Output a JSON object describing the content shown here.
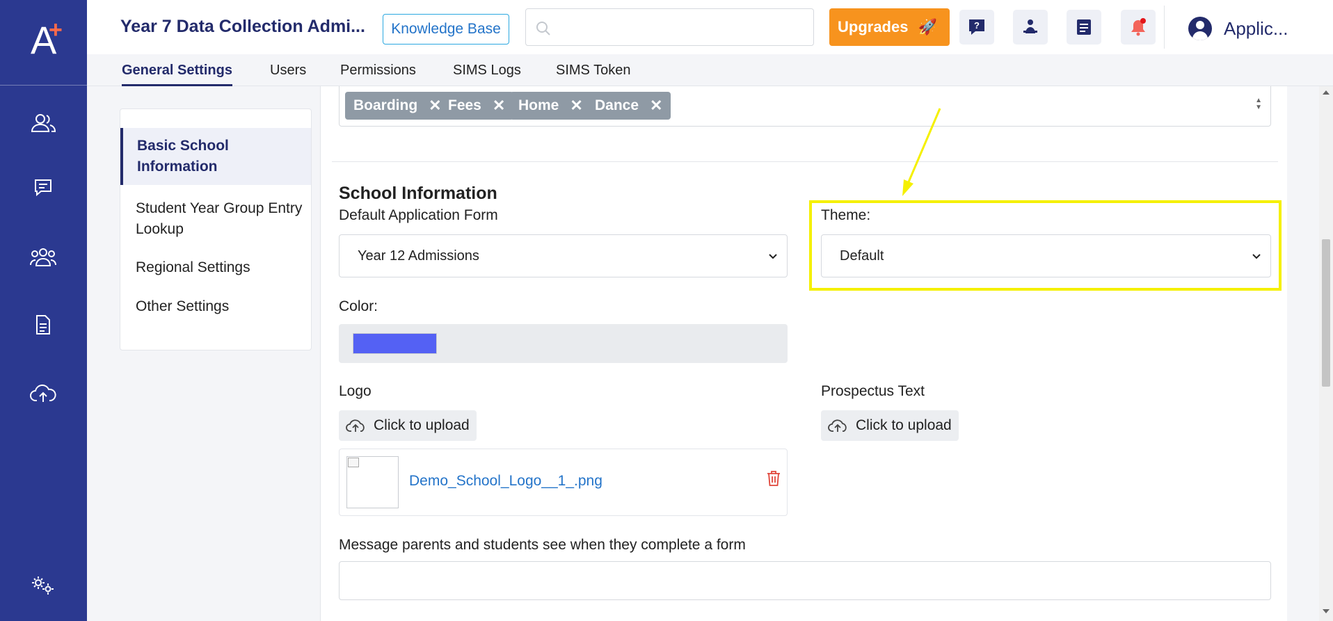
{
  "header": {
    "app_title": "Year 7 Data Collection Admi...",
    "knowledge_base_label": "Knowledge Base",
    "search_placeholder": "",
    "upgrades_label": "Upgrades",
    "user_name": "Applic..."
  },
  "brand": {
    "letter": "A",
    "plus": "+"
  },
  "sidebar": {
    "icons": [
      "users-icon",
      "chat-icon",
      "group-icon",
      "document-icon",
      "cloud-upload-icon",
      "settings-gears-icon"
    ]
  },
  "tabs": [
    "General Settings",
    "Users",
    "Permissions",
    "SIMS Logs",
    "SIMS Token"
  ],
  "active_tab": "General Settings",
  "settings_menu": {
    "items": [
      "Basic School Information",
      "Student Year Group Entry Lookup",
      "Regional Settings",
      "Other Settings"
    ],
    "active": "Basic School Information"
  },
  "tags": [
    "Boarding",
    "Fees",
    "Home",
    "Dance"
  ],
  "school_info": {
    "title": "School Information",
    "default_form_label": "Default Application Form",
    "default_form_value": "Year 12 Admissions",
    "theme_label": "Theme:",
    "theme_value": "Default",
    "color_label": "Color:",
    "color_value": "#5461f4",
    "logo_label": "Logo",
    "prospectus_label": "Prospectus Text",
    "upload_label": "Click to upload",
    "logo_file": "Demo_School_Logo__1_.png",
    "message_label": "Message parents and students see when they complete a form",
    "message_value": ""
  },
  "colors": {
    "sidebar": "#2b3990",
    "title": "#232b6b",
    "accent_link": "#2474c9",
    "upgrade": "#f7931e",
    "highlight": "#f5f000",
    "tag": "#8f9aa5"
  }
}
